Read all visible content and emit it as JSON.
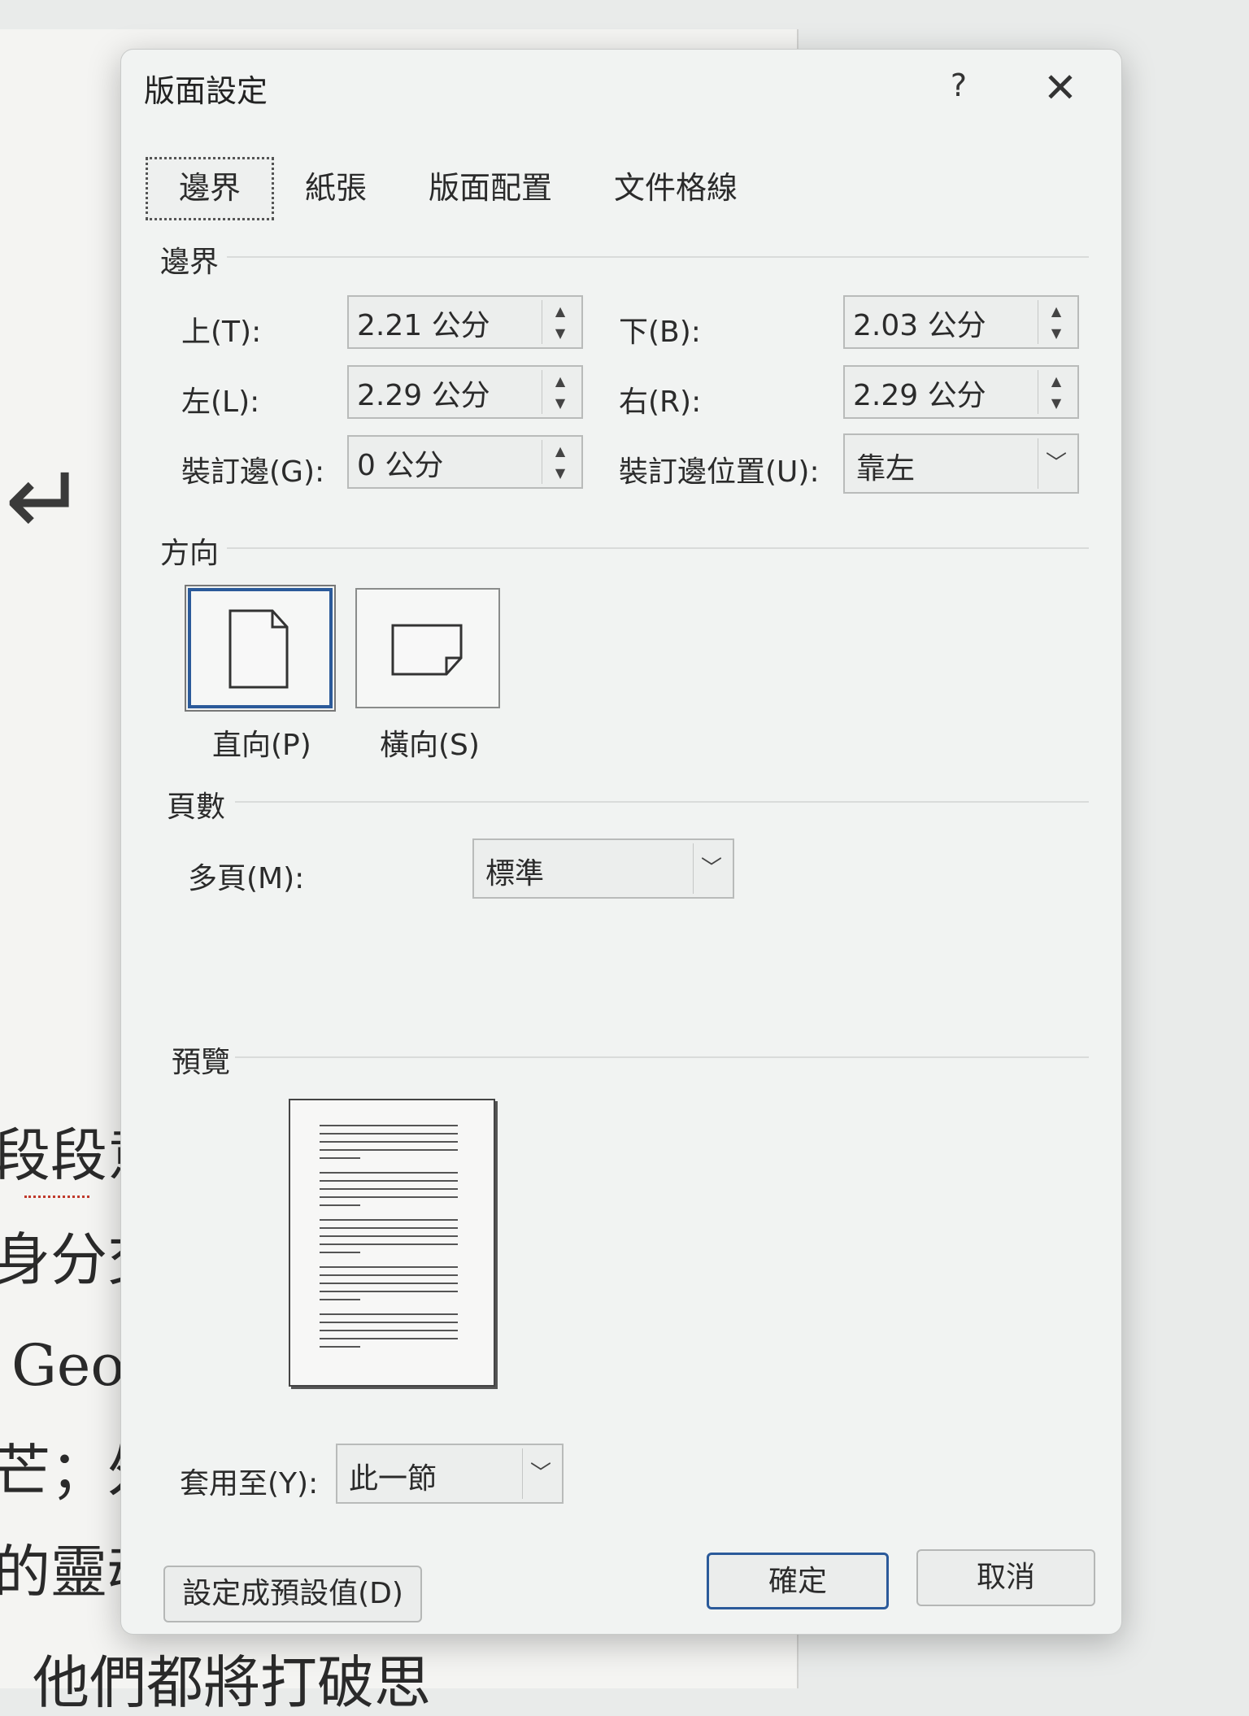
{
  "background_doc": {
    "lines": [
      "段段意",
      "身分交",
      "Geor",
      "芒；外",
      "的靈魂",
      "他們都將打破思"
    ]
  },
  "dialog": {
    "title": "版面設定",
    "help_label": "?",
    "close_label": "✕",
    "tabs": [
      {
        "label": "邊界",
        "active": true
      },
      {
        "label": "紙張",
        "active": false
      },
      {
        "label": "版面配置",
        "active": false
      },
      {
        "label": "文件格線",
        "active": false
      }
    ],
    "margins": {
      "section_label": "邊界",
      "top": {
        "label": "上(T):",
        "value": "2.21 公分"
      },
      "bottom": {
        "label": "下(B):",
        "value": "2.03 公分"
      },
      "left": {
        "label": "左(L):",
        "value": "2.29 公分"
      },
      "right": {
        "label": "右(R):",
        "value": "2.29 公分"
      },
      "gutter": {
        "label": "裝訂邊(G):",
        "value": "0 公分"
      },
      "gutter_position": {
        "label": "裝訂邊位置(U):",
        "value": "靠左"
      }
    },
    "orientation": {
      "section_label": "方向",
      "portrait": {
        "label": "直向(P)",
        "selected": true
      },
      "landscape": {
        "label": "橫向(S)",
        "selected": false
      }
    },
    "pages": {
      "section_label": "頁數",
      "multiple_pages": {
        "label": "多頁(M):",
        "value": "標準"
      }
    },
    "preview": {
      "section_label": "預覽"
    },
    "apply_to": {
      "label": "套用至(Y):",
      "value": "此一節"
    },
    "buttons": {
      "set_default": "設定成預設值(D)",
      "ok": "確定",
      "cancel": "取消"
    },
    "colors": {
      "accent": "#2b5a9a",
      "dialog_bg": "#f1f3f2"
    }
  }
}
